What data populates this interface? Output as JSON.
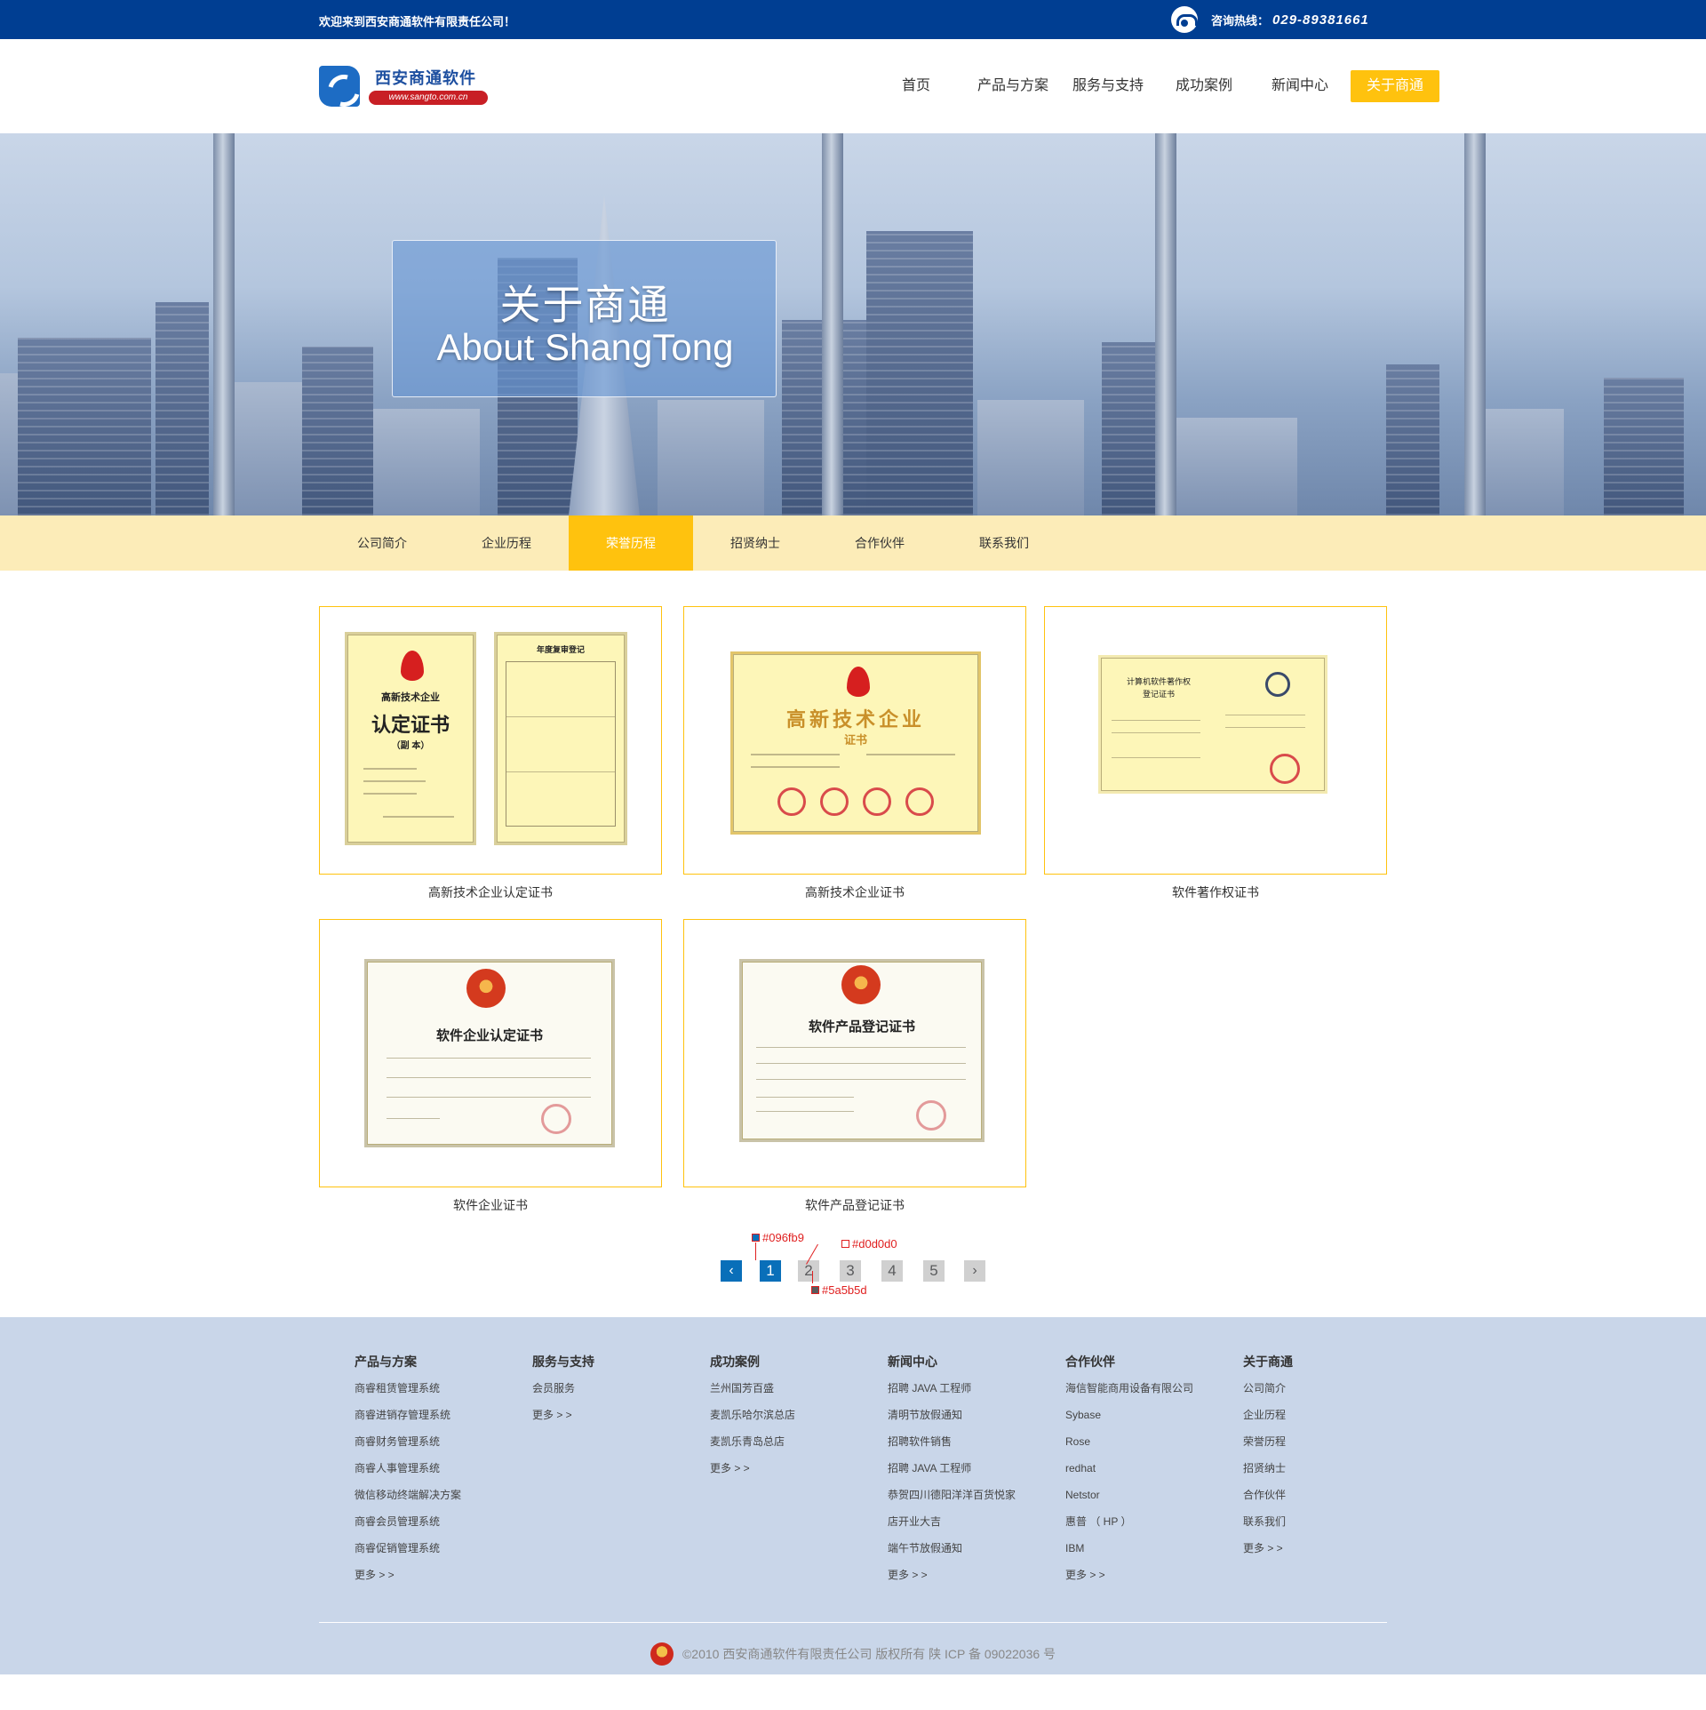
{
  "topbar": {
    "welcome": "欢迎来到西安商通软件有限责任公司！",
    "hotline_label": "咨询热线：",
    "hotline_number": "029-89381661",
    "phone_icon": "phone-icon"
  },
  "logo": {
    "name": "西安商通软件",
    "url": "www.sangto.com.cn"
  },
  "nav": {
    "items": [
      "首页",
      "产品与方案",
      "服务与支持",
      "成功案例",
      "新闻中心",
      "关于商通"
    ],
    "active": "关于商通",
    "accent": "#ffc20e"
  },
  "banner": {
    "title_cn": "关于商通",
    "title_en": "About ShangTong"
  },
  "subnav": {
    "items": [
      "公司简介",
      "企业历程",
      "荣誉历程",
      "招贤纳士",
      "合作伙伴",
      "联系我们"
    ],
    "active": "荣誉历程"
  },
  "gallery": {
    "items": [
      {
        "caption": "高新技术企业认定证书",
        "cert_texts": [
          "高新技术企业",
          "认定证书",
          "（副 本）",
          "年度复审登记"
        ]
      },
      {
        "caption": "高新技术企业证书",
        "cert_texts": [
          "高新技术企业",
          "证书"
        ]
      },
      {
        "caption": "软件著作权证书",
        "cert_texts": [
          "计算机软件著作权",
          "登记证书"
        ]
      },
      {
        "caption": "软件企业证书",
        "cert_texts": [
          "软件企业认定证书"
        ]
      },
      {
        "caption": "软件产品登记证书",
        "cert_texts": [
          "软件产品登记证书"
        ]
      }
    ]
  },
  "pagination": {
    "prev_icon": "chevron-left-icon",
    "next_icon": "chevron-right-icon",
    "pages": [
      "1",
      "2",
      "3",
      "4",
      "5"
    ],
    "active": "1",
    "annotations": [
      "#096fb9",
      "#d0d0d0",
      "#5a5b5d"
    ],
    "colors": {
      "active": "#096fb9",
      "inactive_bg": "#d0d0d0",
      "inactive_text": "#5a5b5d"
    }
  },
  "footer": {
    "columns": [
      {
        "title": "产品与方案",
        "items": [
          "商睿租赁管理系统",
          "商睿进销存管理系统",
          "商睿财务管理系统",
          "商睿人事管理系统",
          "微信移动终端解决方案",
          "商睿会员管理系统",
          "商睿促销管理系统",
          "更多 > >"
        ]
      },
      {
        "title": "服务与支持",
        "items": [
          "会员服务",
          "更多 > >"
        ]
      },
      {
        "title": "成功案例",
        "items": [
          "兰州国芳百盛",
          "麦凯乐哈尔滨总店",
          "麦凯乐青岛总店",
          "更多 > >"
        ]
      },
      {
        "title": "新闻中心",
        "items": [
          "招聘 JAVA 工程师",
          "清明节放假通知",
          "招聘软件销售",
          "招聘 JAVA 工程师",
          "恭贺四川德阳洋洋百货悦家",
          "店开业大吉",
          "端午节放假通知",
          "更多 > >"
        ]
      },
      {
        "title": "合作伙伴",
        "items": [
          "海信智能商用设备有限公司",
          "Sybase",
          "Rose",
          "redhat",
          "Netstor",
          "惠普 （ HP ）",
          "IBM",
          "更多 > >"
        ]
      },
      {
        "title": "关于商通",
        "items": [
          "公司简介",
          "企业历程",
          "荣誉历程",
          "招贤纳士",
          "合作伙伴",
          "联系我们",
          "更多 > >"
        ]
      }
    ],
    "copyright": "©2010 西安商通软件有限责任公司 版权所有    陕 ICP 备 09022036 号",
    "police_icon": "police-badge-icon",
    "bg": "#c9d6e9"
  }
}
